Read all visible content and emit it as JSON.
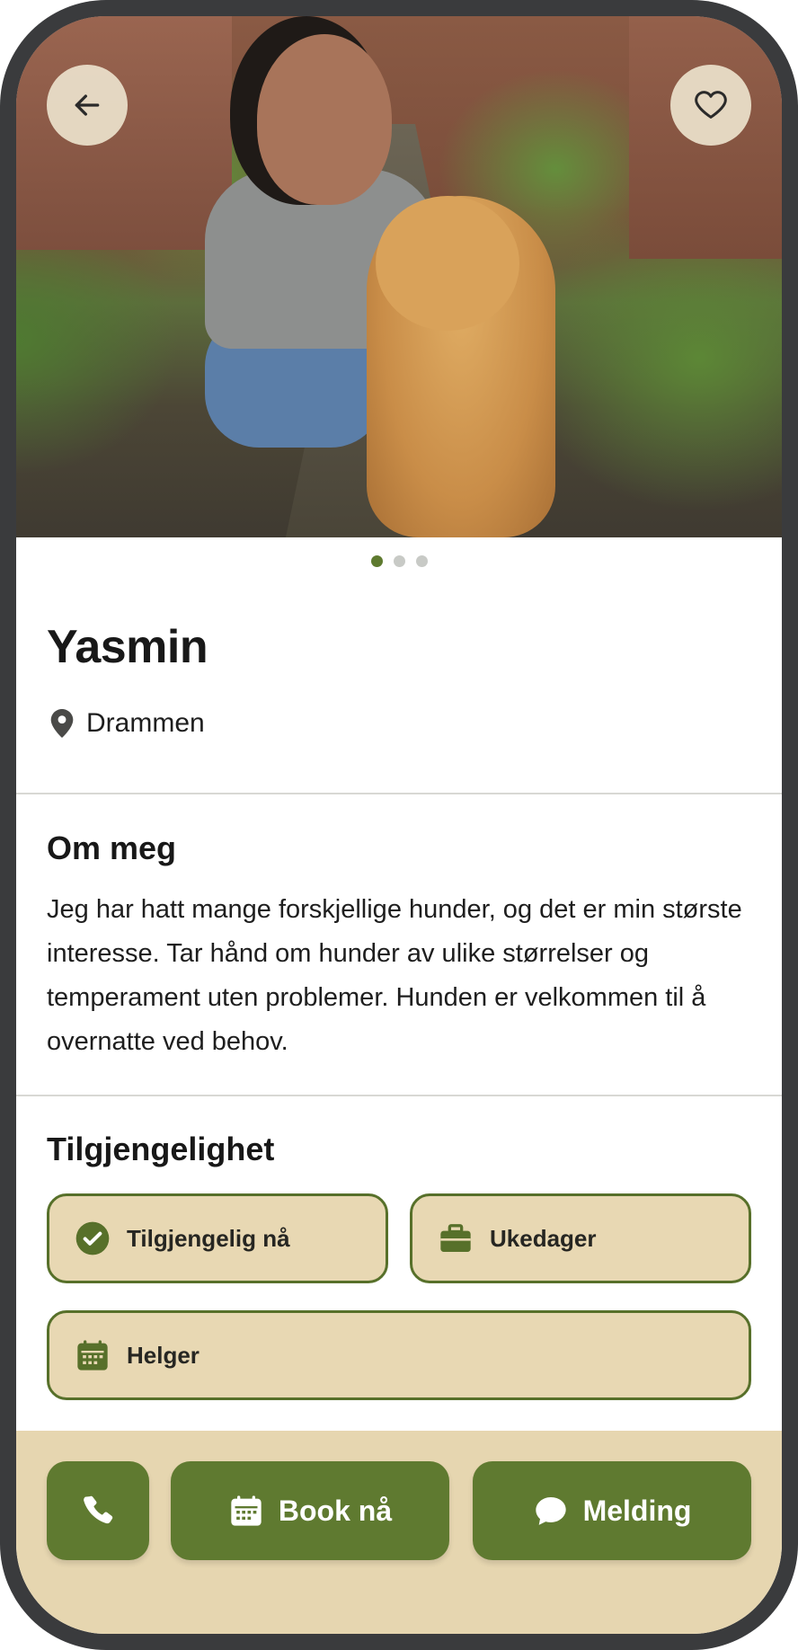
{
  "profile": {
    "name": "Yasmin",
    "location": "Drammen",
    "photo_count": 3,
    "active_photo": 1
  },
  "about": {
    "heading": "Om meg",
    "text": "Jeg har hatt mange forskjellige hunder, og det er min største interesse. Tar hånd om hunder av ulike størrelser og temperament uten problemer. Hunden er velkommen til å overnatte ved behov."
  },
  "availability": {
    "heading": "Tilgjengelighet",
    "items": [
      {
        "label": "Tilgjengelig nå",
        "icon": "check-circle-icon"
      },
      {
        "label": "Ukedager",
        "icon": "briefcase-icon"
      },
      {
        "label": "Helger",
        "icon": "calendar-icon"
      }
    ]
  },
  "actions": {
    "call_icon": "phone-icon",
    "book_label": "Book nå",
    "message_label": "Melding"
  },
  "colors": {
    "accent": "#5f7a30",
    "pill_bg": "#e8d8b3",
    "bottom_bar": "#e6d6b0",
    "frame": "#3a3b3d"
  }
}
